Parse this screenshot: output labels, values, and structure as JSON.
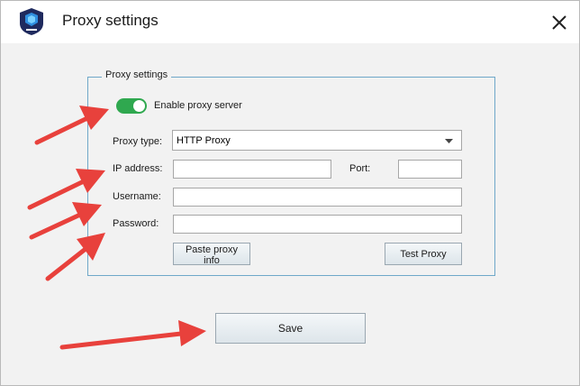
{
  "window": {
    "title": "Proxy settings"
  },
  "group": {
    "legend": "Proxy settings"
  },
  "proxy_toggle": {
    "label": "Enable proxy server",
    "enabled": true,
    "color": "#2fa84f"
  },
  "proxy_type": {
    "label": "Proxy type:",
    "value": "HTTP Proxy"
  },
  "ip_address": {
    "label": "IP address:",
    "value": ""
  },
  "port": {
    "label": "Port:",
    "value": ""
  },
  "username": {
    "label": "Username:",
    "value": ""
  },
  "password": {
    "label": "Password:",
    "value": ""
  },
  "buttons": {
    "paste": "Paste proxy info",
    "test": "Test Proxy",
    "save": "Save"
  },
  "annotation_color": "#e8413c"
}
